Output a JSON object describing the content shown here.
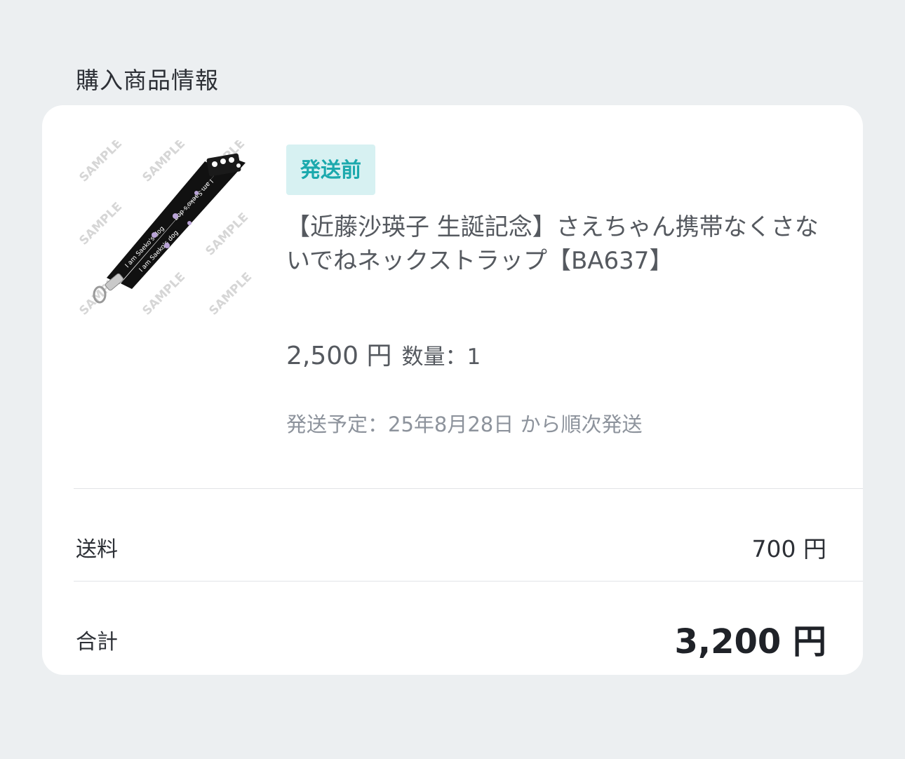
{
  "section_title": "購入商品情報",
  "item": {
    "status_badge": "発送前",
    "name": "【近藤沙瑛子 生誕記念】さえちゃん携帯なくさないでねネックストラップ【BA637】",
    "price": "2,500 円",
    "quantity": "数量：1",
    "shipping_plan": "発送予定：25年8月28日 から順次発送",
    "image": {
      "watermark": "SAMPLE",
      "strap_text": "I am Saeko's dog"
    }
  },
  "summary": {
    "shipping_label": "送料",
    "shipping_value": "700 円",
    "total_label": "合計",
    "total_value": "3,200 円"
  },
  "colors": {
    "background": "#eceff1",
    "card": "#ffffff",
    "badge_bg": "#d7f1f2",
    "badge_text": "#1ba9ad",
    "strap": "#111111"
  }
}
